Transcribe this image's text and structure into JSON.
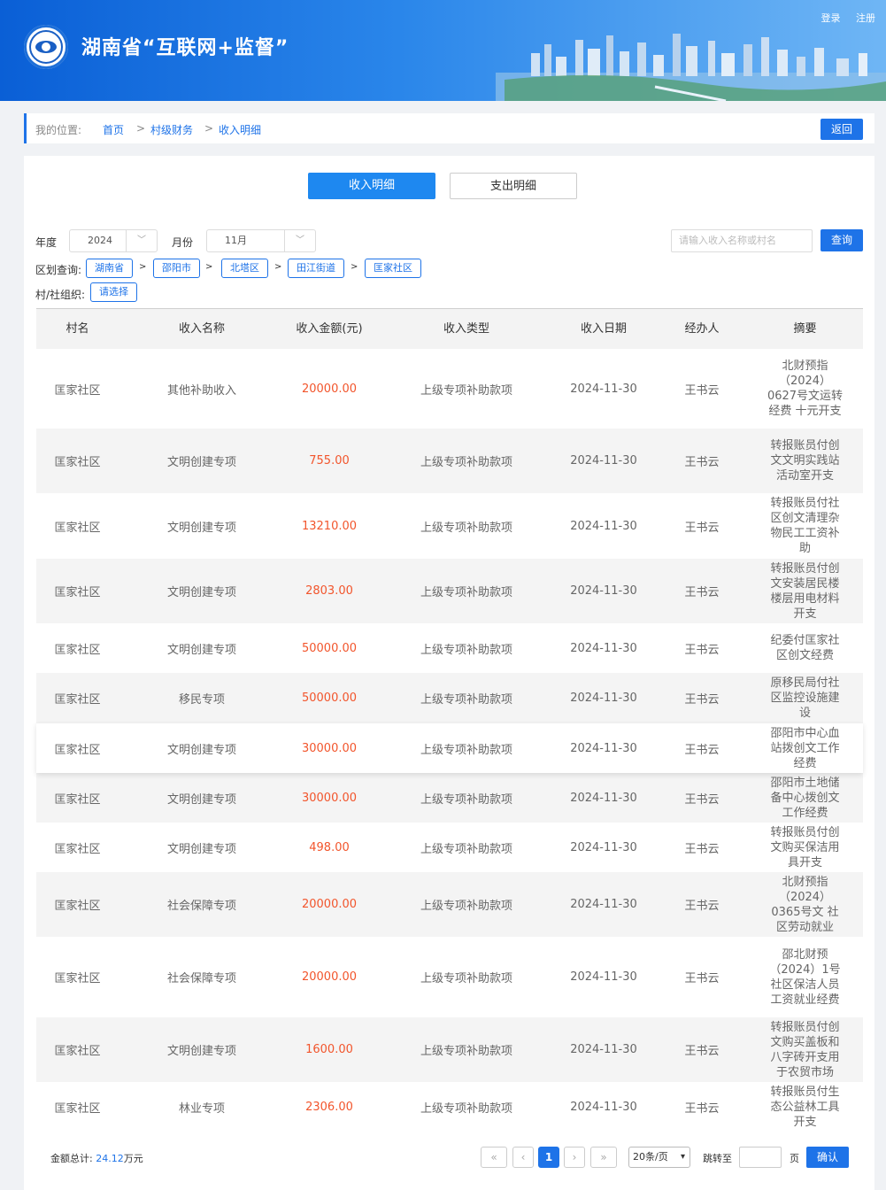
{
  "header": {
    "title": "湖南省“互联网+监督”",
    "login": "登录",
    "register": "注册"
  },
  "breadcrumb": {
    "label": "我的位置:",
    "items": [
      "首页",
      "村级财务",
      "收入明细"
    ],
    "separator": ">",
    "back_label": "返回"
  },
  "tabs": [
    {
      "label": "收入明细",
      "active": true
    },
    {
      "label": "支出明细",
      "active": false
    }
  ],
  "filters": {
    "year_label": "年度",
    "year_value": "2024",
    "month_label": "月份",
    "month_value": "11月",
    "search_placeholder": "请输入收入名称或村名",
    "query_label": "查询",
    "region_label": "区划查询:",
    "regions": [
      "湖南省",
      "邵阳市",
      "北塔区",
      "田江街道",
      "匡家社区"
    ],
    "org_label": "村/社组织:",
    "org_value": "请选择"
  },
  "table": {
    "headers": [
      "村名",
      "收入名称",
      "收入金额(元)",
      "收入类型",
      "收入日期",
      "经办人",
      "摘要"
    ],
    "rows": [
      {
        "village": "匡家社区",
        "name": "其他补助收入",
        "amount": "20000.00",
        "type": "上级专项补助款项",
        "date": "2024-11-30",
        "handler": "王书云",
        "summary": "北财预指（2024）0627号文运转经费 十元开支"
      },
      {
        "village": "匡家社区",
        "name": "文明创建专项",
        "amount": "755.00",
        "type": "上级专项补助款项",
        "date": "2024-11-30",
        "handler": "王书云",
        "summary": "转报账员付创文文明实践站活动室开支"
      },
      {
        "village": "匡家社区",
        "name": "文明创建专项",
        "amount": "13210.00",
        "type": "上级专项补助款项",
        "date": "2024-11-30",
        "handler": "王书云",
        "summary": "转报账员付社区创文清理杂物民工工资补助"
      },
      {
        "village": "匡家社区",
        "name": "文明创建专项",
        "amount": "2803.00",
        "type": "上级专项补助款项",
        "date": "2024-11-30",
        "handler": "王书云",
        "summary": "转报账员付创文安装居民楼楼层用电材料开支"
      },
      {
        "village": "匡家社区",
        "name": "文明创建专项",
        "amount": "50000.00",
        "type": "上级专项补助款项",
        "date": "2024-11-30",
        "handler": "王书云",
        "summary": "纪委付匡家社区创文经费"
      },
      {
        "village": "匡家社区",
        "name": "移民专项",
        "amount": "50000.00",
        "type": "上级专项补助款项",
        "date": "2024-11-30",
        "handler": "王书云",
        "summary": "原移民局付社区监控设施建设"
      },
      {
        "village": "匡家社区",
        "name": "文明创建专项",
        "amount": "30000.00",
        "type": "上级专项补助款项",
        "date": "2024-11-30",
        "handler": "王书云",
        "summary": "邵阳市中心血站拨创文工作经费"
      },
      {
        "village": "匡家社区",
        "name": "文明创建专项",
        "amount": "30000.00",
        "type": "上级专项补助款项",
        "date": "2024-11-30",
        "handler": "王书云",
        "summary": "邵阳市土地储备中心拨创文工作经费"
      },
      {
        "village": "匡家社区",
        "name": "文明创建专项",
        "amount": "498.00",
        "type": "上级专项补助款项",
        "date": "2024-11-30",
        "handler": "王书云",
        "summary": "转报账员付创文购买保洁用具开支"
      },
      {
        "village": "匡家社区",
        "name": "社会保障专项",
        "amount": "20000.00",
        "type": "上级专项补助款项",
        "date": "2024-11-30",
        "handler": "王书云",
        "summary": "北财预指（2024）0365号文 社区劳动就业"
      },
      {
        "village": "匡家社区",
        "name": "社会保障专项",
        "amount": "20000.00",
        "type": "上级专项补助款项",
        "date": "2024-11-30",
        "handler": "王书云",
        "summary": "邵北财预（2024）1号 社区保洁人员工资就业经费"
      },
      {
        "village": "匡家社区",
        "name": "文明创建专项",
        "amount": "1600.00",
        "type": "上级专项补助款项",
        "date": "2024-11-30",
        "handler": "王书云",
        "summary": "转报账员付创文购买盖板和八字砖开支用于农贸市场"
      },
      {
        "village": "匡家社区",
        "name": "林业专项",
        "amount": "2306.00",
        "type": "上级专项补助款项",
        "date": "2024-11-30",
        "handler": "王书云",
        "summary": "转报账员付生态公益林工具开支"
      }
    ]
  },
  "footer": {
    "total_label": "金额总计:",
    "total_value": "24.12",
    "total_unit": "万元",
    "first_icon": "double-left-icon",
    "prev_icon": "left-icon",
    "current_page": "1",
    "next_icon": "right-icon",
    "last_icon": "double-right-icon",
    "page_size": "20条/页",
    "jump_label": "跳转至",
    "page_unit": "页",
    "confirm_label": "确认"
  },
  "colors": {
    "accent": "#1e73e8",
    "amount": "#f2552c",
    "header_start": "#0a5fd6"
  }
}
